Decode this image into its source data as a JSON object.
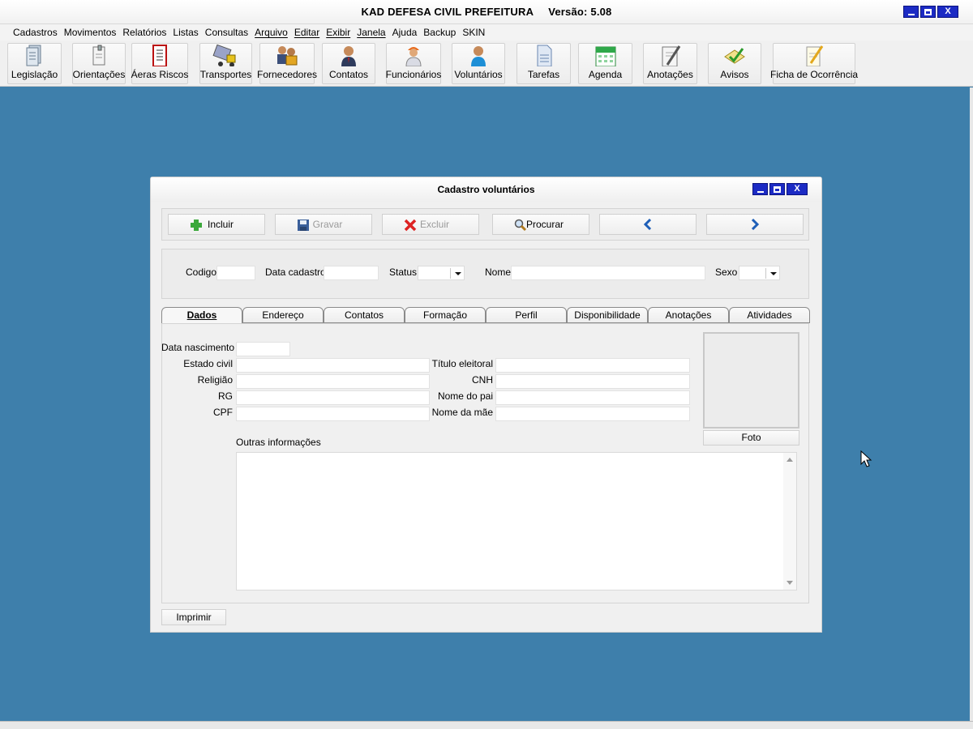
{
  "app": {
    "title": "KAD DEFESA CIVIL PREFEITURA",
    "version": "Versão: 5.08",
    "window_buttons": {
      "minimize": "_",
      "maximize": "□",
      "close": "X"
    }
  },
  "menu": [
    "Cadastros",
    "Movimentos",
    "Relatórios",
    "Listas",
    "Consultas",
    "Arquivo",
    "Editar",
    "Exibir",
    "Janela",
    "Ajuda",
    "Backup",
    "SKIN"
  ],
  "toolbar": [
    {
      "label": "Legislação",
      "icon": "document-stack-icon"
    },
    {
      "label": "Orientações",
      "icon": "clipboard-icon"
    },
    {
      "label": "Áeras Riscos",
      "icon": "risk-list-icon"
    },
    {
      "label": "Transportes",
      "icon": "truck-icon"
    },
    {
      "label": "Fornecedores",
      "icon": "suppliers-icon"
    },
    {
      "label": "Contatos",
      "icon": "contact-person-icon"
    },
    {
      "label": "Funcionários",
      "icon": "worker-icon"
    },
    {
      "label": "Voluntários",
      "icon": "volunteer-icon"
    },
    {
      "label": "Tarefas",
      "icon": "task-page-icon"
    },
    {
      "label": "Agenda",
      "icon": "calendar-icon"
    },
    {
      "label": "Anotações",
      "icon": "notepad-icon"
    },
    {
      "label": "Avisos",
      "icon": "notice-check-icon"
    },
    {
      "label": "Ficha de Ocorrência",
      "icon": "occurrence-sheet-icon"
    }
  ],
  "dialog": {
    "title": "Cadastro voluntários",
    "actions": {
      "incluir": "Incluir",
      "gravar": "Gravar",
      "excluir": "Excluir",
      "procurar": "Procurar"
    },
    "header_fields": {
      "codigo_label": "Codigo",
      "codigo_value": "",
      "data_cadastro_label": "Data cadastro",
      "data_cadastro_value": "",
      "status_label": "Status",
      "status_value": "",
      "nome_label": "Nome",
      "nome_value": "",
      "sexo_label": "Sexo",
      "sexo_value": ""
    },
    "tabs": [
      "Dados",
      "Endereço",
      "Contatos",
      "Formação",
      "Perfil",
      "Disponibilidade",
      "Anotações",
      "Atividades"
    ],
    "active_tab": "Dados",
    "dados": {
      "data_nascimento": "Data nascimento",
      "estado_civil": "Estado civil",
      "religiao": "Religião",
      "rg": "RG",
      "cpf": "CPF",
      "titulo_eleitoral": "Título eleitoral",
      "cnh": "CNH",
      "nome_pai": "Nome do pai",
      "nome_mae": "Nome da mãe",
      "outras_informacoes": "Outras informações",
      "foto_button": "Foto"
    },
    "print_button": "Imprimir"
  },
  "colors": {
    "desktop": "#3e7fab",
    "window_button": "#1c2bc4",
    "nav_arrow": "#1f5fb8"
  }
}
